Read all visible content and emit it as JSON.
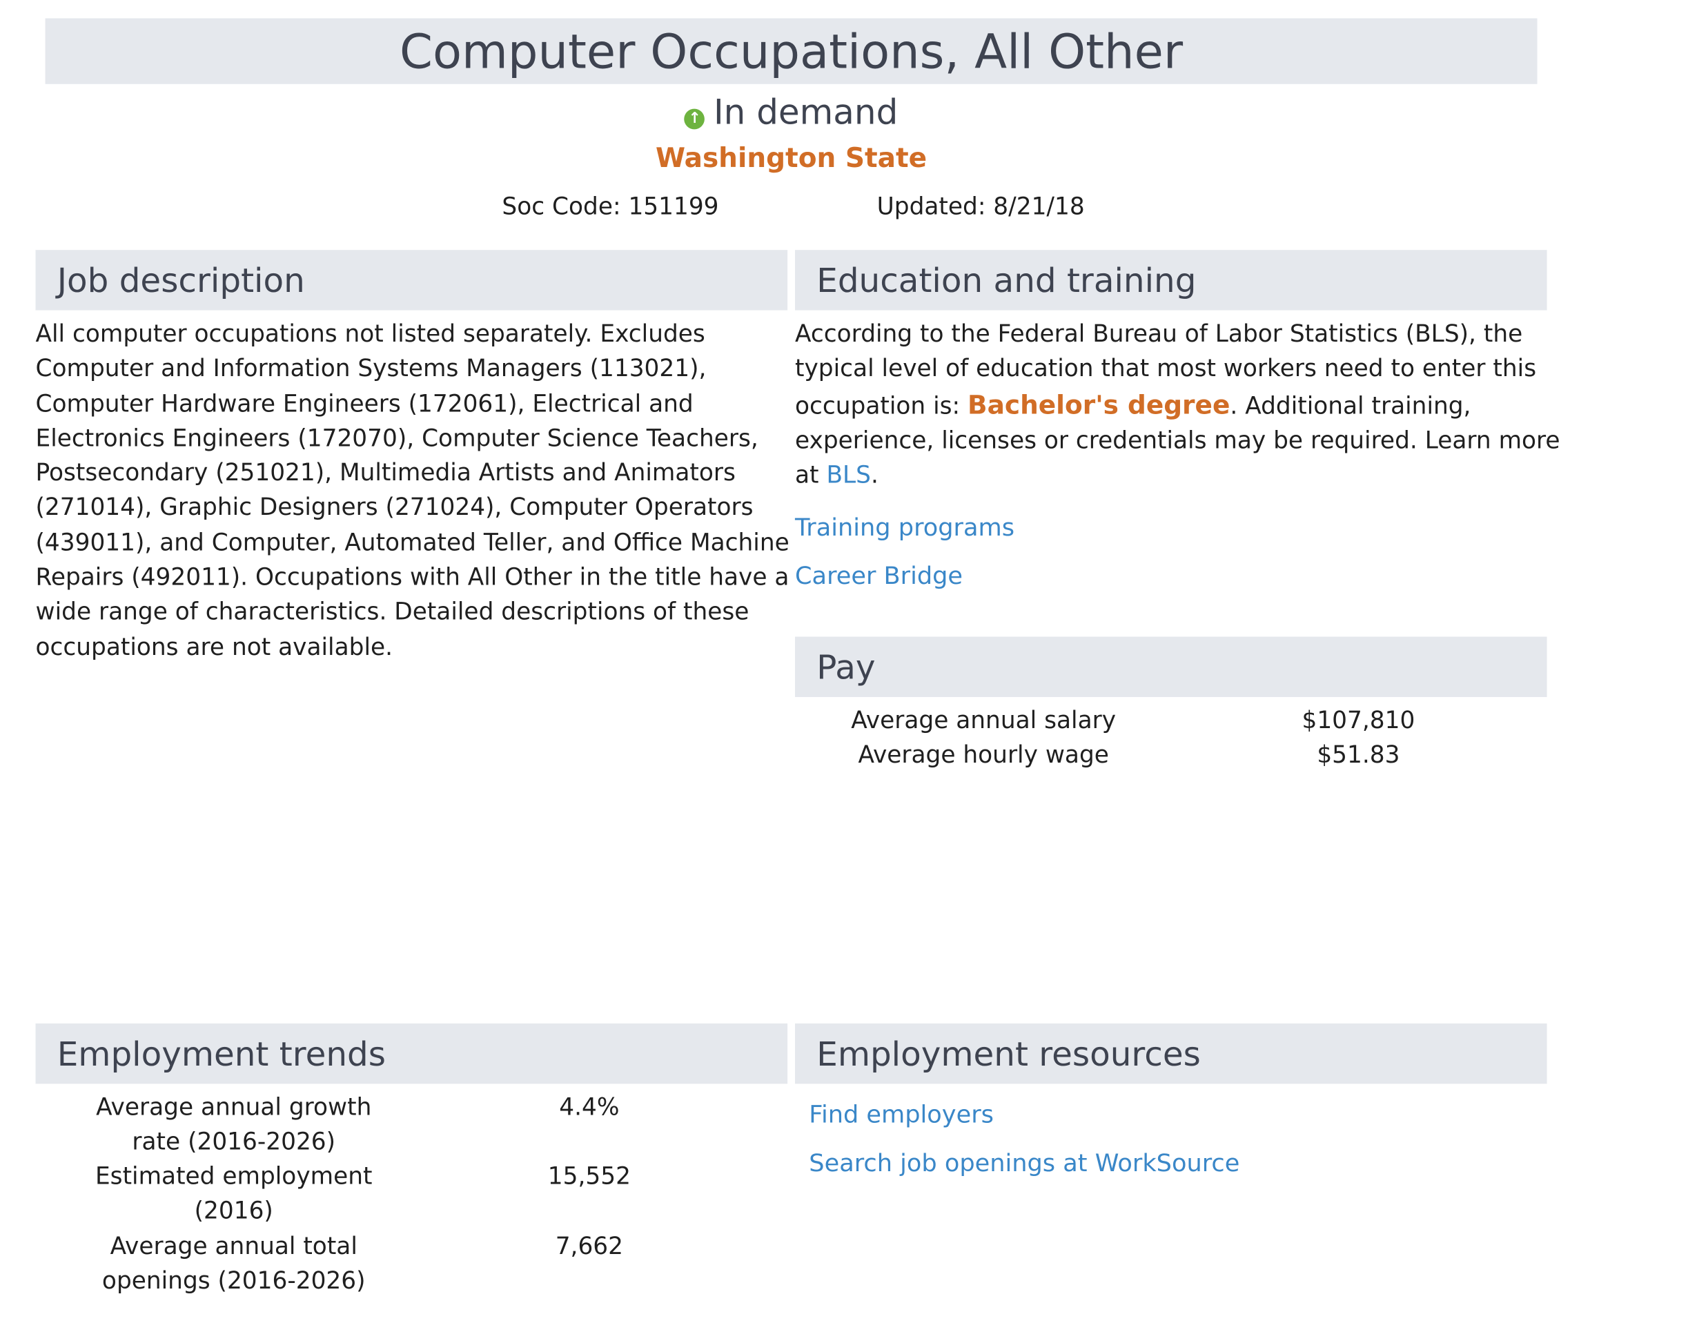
{
  "header": {
    "title": "Computer Occupations, All Other",
    "demand_label": "In demand",
    "demand_icon": "arrow-up-circle-icon",
    "demand_icon_color": "#6db33f",
    "state": "Washington State",
    "soc_code": "Soc Code: 151199",
    "updated": "Updated: 8/21/18"
  },
  "colors": {
    "accent_orange": "#d16d26",
    "link_blue": "#3a87c8",
    "section_bg": "#e5e8ed"
  },
  "job_description": {
    "heading": "Job description",
    "lines": [
      "All computer occupations not listed separately. Excludes",
      "Computer and Information Systems Managers (113021),",
      "Computer Hardware Engineers (172061), Electrical and",
      "Electronics Engineers (172070), Computer Science Teachers,",
      "Postsecondary (251021), Multimedia Artists and Animators",
      "(271014), Graphic Designers (271024), Computer Operators",
      "(439011), and Computer, Automated Teller, and Office Machine",
      "Repairs (492011). Occupations with All Other in the title have a",
      "wide range of characteristics. Detailed descriptions of these",
      "occupations are not available."
    ]
  },
  "education": {
    "heading": "Education and training",
    "line1": "According to the Federal Bureau of Labor Statistics (BLS), the",
    "line2": "typical level of education that most workers need to enter this",
    "line3_prefix": "occupation is: ",
    "degree": "Bachelor's degree",
    "line3_suffix": ". Additional training,",
    "line4": "experience, licenses or credentials may be required. Learn more",
    "line5_prefix": "at ",
    "bls_link": "BLS",
    "line5_suffix": ".",
    "links": [
      "Training programs",
      "Career Bridge"
    ]
  },
  "pay": {
    "heading": "Pay",
    "rows": [
      {
        "label": "Average annual salary",
        "value": "$107,810"
      },
      {
        "label": "Average hourly wage",
        "value": "$51.83"
      }
    ]
  },
  "trends": {
    "heading": "Employment trends",
    "rows": [
      {
        "label_line1": "Average annual growth",
        "label_line2": "rate (2016-2026)",
        "value": "4.4%"
      },
      {
        "label_line1": "Estimated employment",
        "label_line2": "(2016)",
        "value": "15,552"
      },
      {
        "label_line1": "Average annual total",
        "label_line2": "openings (2016-2026)",
        "value": "7,662"
      }
    ]
  },
  "resources": {
    "heading": "Employment resources",
    "links": [
      "Find employers",
      "Search job openings at WorkSource"
    ]
  }
}
